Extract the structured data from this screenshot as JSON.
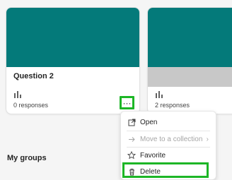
{
  "cards": [
    {
      "title": "Question 2",
      "responses": "0 responses",
      "banner_color": "#047a7a"
    },
    {
      "title": "",
      "responses": "2 responses",
      "banner_color": "#047a7a"
    }
  ],
  "more_button": {
    "label": "···",
    "icon": "more-horizontal-icon"
  },
  "context_menu": {
    "items": [
      {
        "label": "Open",
        "icon": "open-external-icon",
        "enabled": true
      },
      {
        "label": "Move to a collection",
        "icon": "move-arrow-icon",
        "enabled": false
      },
      {
        "label": "Favorite",
        "icon": "star-icon",
        "enabled": true
      },
      {
        "label": "Delete",
        "icon": "trash-icon",
        "enabled": true
      }
    ]
  },
  "sections": {
    "my_groups": "My groups"
  },
  "colors": {
    "accent_teal": "#047a7a",
    "highlight_green": "#1db626"
  }
}
